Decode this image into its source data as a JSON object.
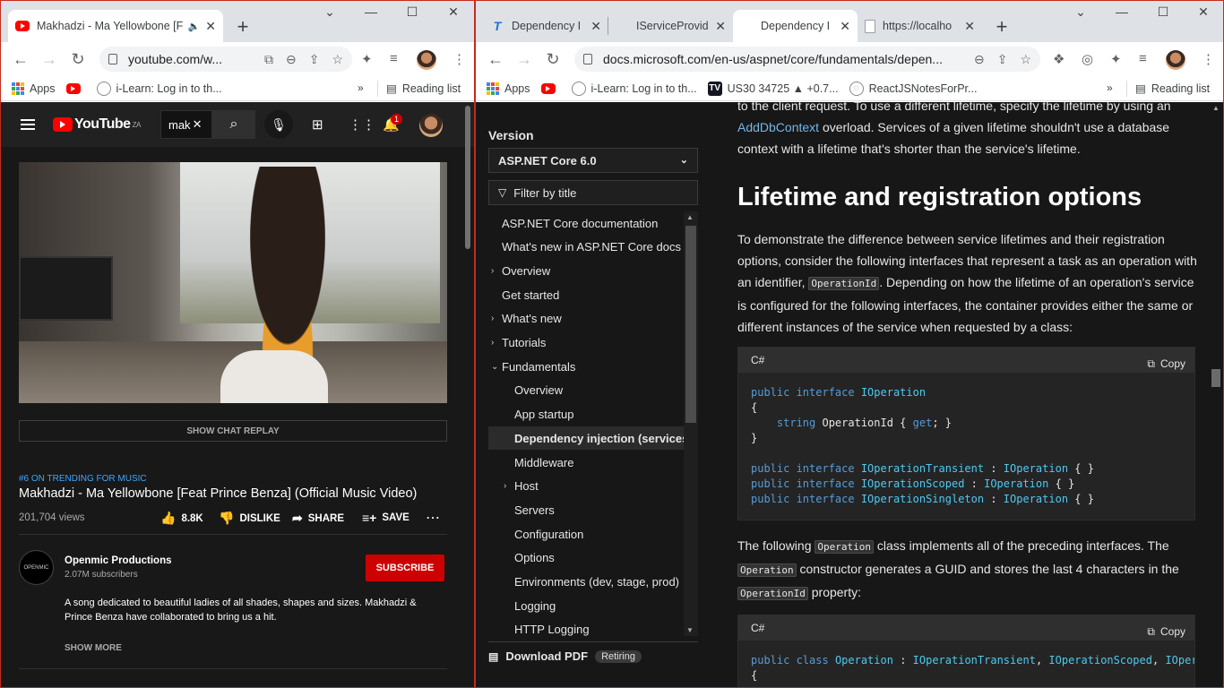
{
  "left_window": {
    "tab": {
      "title": "Makhadzi - Ma Yellowbone [F",
      "audio_icon": "speaker-icon"
    },
    "address": "youtube.com/w...",
    "bookmarks": [
      {
        "label": "Apps",
        "icon": "apps-grid-icon"
      },
      {
        "label": "",
        "icon": "youtube-icon"
      },
      {
        "label": "i-Learn: Log in to th...",
        "icon": "ilearn-icon"
      }
    ],
    "reading_list": "Reading list",
    "youtube": {
      "country": "ZA",
      "search_value": "mak",
      "notification_count": "1",
      "show_chat_replay": "SHOW CHAT REPLAY",
      "trending": "#6 ON TRENDING FOR MUSIC",
      "video_title": "Makhadzi - Ma Yellowbone [Feat Prince Benza] (Official Music Video)",
      "views": "201,704 views",
      "actions": {
        "likes": "8.8K",
        "dislike": "DISLIKE",
        "share": "SHARE",
        "save": "SAVE"
      },
      "channel": {
        "name": "Openmic Productions",
        "subscribers": "2.07M subscribers"
      },
      "subscribe": "SUBSCRIBE",
      "description": "A song dedicated to beautiful ladies of all shades, shapes and sizes. Makhadzi & Prince Benza have collaborated to bring us a hit.",
      "show_more": "SHOW MORE"
    }
  },
  "right_window": {
    "tabs": [
      {
        "title": "Dependency I",
        "icon": "typora-icon"
      },
      {
        "title": "IServiceProvid",
        "icon": "microsoft-icon"
      },
      {
        "title": "Dependency I",
        "icon": "microsoft-icon",
        "active": true
      },
      {
        "title": "https://localho",
        "icon": "document-icon"
      }
    ],
    "address": "docs.microsoft.com/en-us/aspnet/core/fundamentals/depen...",
    "bookmarks": [
      {
        "label": "Apps",
        "icon": "apps-grid-icon"
      },
      {
        "label": "",
        "icon": "youtube-icon"
      },
      {
        "label": "i-Learn: Log in to th...",
        "icon": "ilearn-icon"
      },
      {
        "label": "US30 34725 ▲ +0.7...",
        "icon": "tradingview-icon"
      },
      {
        "label": "ReactJSNotesForPr...",
        "icon": "globe-icon"
      }
    ],
    "reading_list": "Reading list",
    "docs": {
      "version_label": "Version",
      "version_value": "ASP.NET Core 6.0",
      "filter_placeholder": "Filter by title",
      "toc": [
        {
          "label": "ASP.NET Core documentation",
          "level": 0
        },
        {
          "label": "What's new in ASP.NET Core docs",
          "level": 0
        },
        {
          "label": "Overview",
          "level": 0,
          "expander": "›"
        },
        {
          "label": "Get started",
          "level": 0
        },
        {
          "label": "What's new",
          "level": 0,
          "expander": "›"
        },
        {
          "label": "Tutorials",
          "level": 0,
          "expander": "›"
        },
        {
          "label": "Fundamentals",
          "level": 0,
          "expander": "⌄"
        },
        {
          "label": "Overview",
          "level": 1
        },
        {
          "label": "App startup",
          "level": 1
        },
        {
          "label": "Dependency injection (services)",
          "level": 1,
          "selected": true
        },
        {
          "label": "Middleware",
          "level": 1
        },
        {
          "label": "Host",
          "level": 1,
          "expander": "›"
        },
        {
          "label": "Servers",
          "level": 1
        },
        {
          "label": "Configuration",
          "level": 1
        },
        {
          "label": "Options",
          "level": 1
        },
        {
          "label": "Environments (dev, stage, prod)",
          "level": 1
        },
        {
          "label": "Logging",
          "level": 1
        },
        {
          "label": "HTTP Logging",
          "level": 1
        }
      ],
      "download_pdf": "Download PDF",
      "retiring": "Retiring",
      "top_para_a": "to the client request. To use a different lifetime, specify the lifetime by using an",
      "top_link": "AddDbContext",
      "top_para_b": " overload. Services of a given lifetime shouldn't use a database context with a lifetime that's shorter than the service's lifetime.",
      "heading": "Lifetime and registration options",
      "para1_a": "To demonstrate the difference between service lifetimes and their registration options, consider the following interfaces that represent a task as an operation with an identifier, ",
      "para1_code": "OperationId",
      "para1_b": ". Depending on how the lifetime of an operation's service is configured for the following interfaces, the container provides either the same or different instances of the service when requested by a class:",
      "code_lang": "C#",
      "copy_label": "Copy",
      "para2_a": "The following ",
      "para2_code1": "Operation",
      "para2_b": " class implements all of the preceding interfaces. The ",
      "para2_code2": "Operation",
      "para2_c": " constructor generates a GUID and stores the last 4 characters in the ",
      "para2_code3": "OperationId",
      "para2_d": " property:",
      "code1_lines": [
        [
          [
            "kw",
            "public "
          ],
          [
            "kw",
            "interface "
          ],
          [
            "ty",
            "IOperation"
          ]
        ],
        [
          [
            "pl",
            "{"
          ]
        ],
        [
          [
            "pl",
            "    "
          ],
          [
            "kw",
            "string "
          ],
          [
            "pl",
            "OperationId { "
          ],
          [
            "kw",
            "get"
          ],
          [
            "pl",
            "; }"
          ]
        ],
        [
          [
            "pl",
            "}"
          ]
        ],
        [
          [
            "pl",
            ""
          ]
        ],
        [
          [
            "kw",
            "public "
          ],
          [
            "kw",
            "interface "
          ],
          [
            "ty",
            "IOperationTransient"
          ],
          [
            "pl",
            " : "
          ],
          [
            "ty",
            "IOperation"
          ],
          [
            "pl",
            " { }"
          ]
        ],
        [
          [
            "kw",
            "public "
          ],
          [
            "kw",
            "interface "
          ],
          [
            "ty",
            "IOperationScoped"
          ],
          [
            "pl",
            " : "
          ],
          [
            "ty",
            "IOperation"
          ],
          [
            "pl",
            " { }"
          ]
        ],
        [
          [
            "kw",
            "public "
          ],
          [
            "kw",
            "interface "
          ],
          [
            "ty",
            "IOperationSingleton"
          ],
          [
            "pl",
            " : "
          ],
          [
            "ty",
            "IOperation"
          ],
          [
            "pl",
            " { }"
          ]
        ]
      ],
      "code2_lines": [
        [
          [
            "kw",
            "public "
          ],
          [
            "kw",
            "class "
          ],
          [
            "ty",
            "Operation"
          ],
          [
            "pl",
            " : "
          ],
          [
            "ty",
            "IOperationTransient"
          ],
          [
            "pl",
            ", "
          ],
          [
            "ty",
            "IOperationScoped"
          ],
          [
            "pl",
            ", "
          ],
          [
            "ty",
            "IOperati"
          ]
        ],
        [
          [
            "pl",
            "{"
          ]
        ]
      ]
    }
  }
}
